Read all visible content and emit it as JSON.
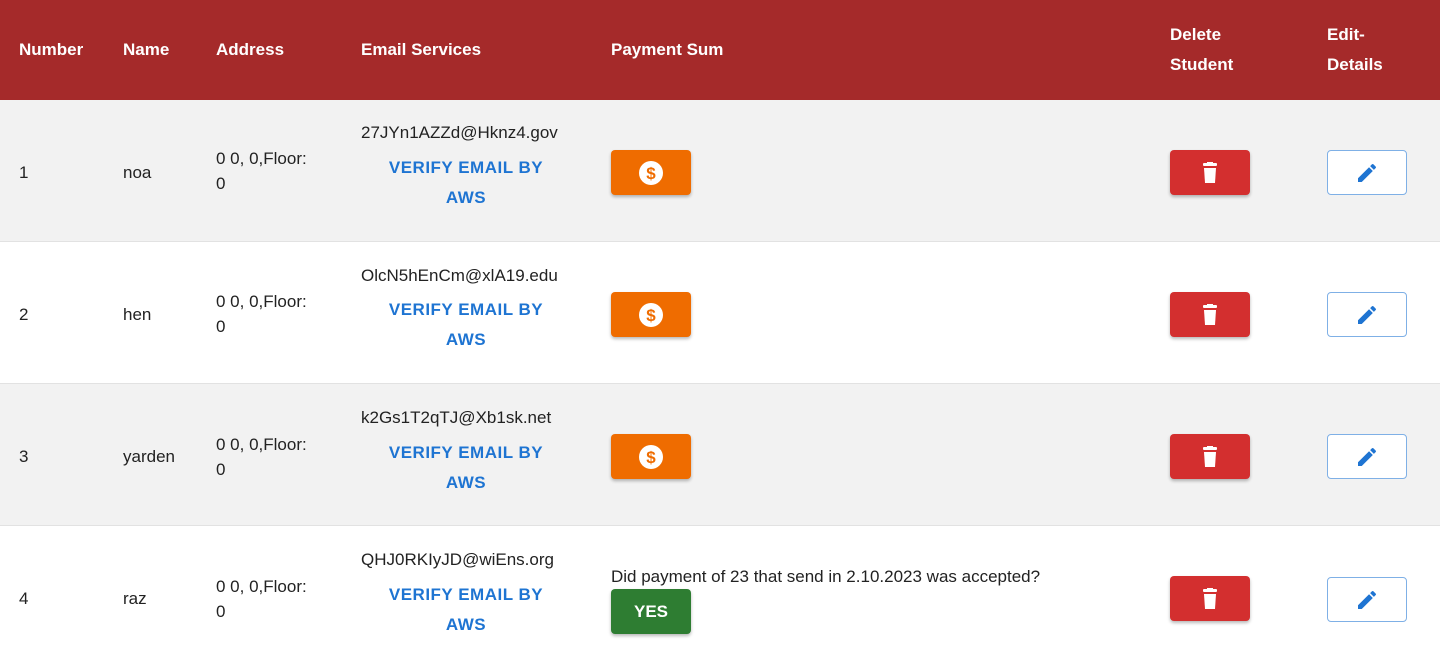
{
  "colors": {
    "header_bg": "#a52a2a",
    "payment_button": "#ef6c00",
    "delete_button": "#d32f2f",
    "edit_icon": "#1e74d2",
    "verify_link": "#1e74d2",
    "yes_button": "#2e7d32"
  },
  "header": {
    "number": "Number",
    "name": "Name",
    "address": "Address",
    "email_services": "Email Services",
    "payment_sum": "Payment Sum",
    "delete_student_line1": "Delete",
    "delete_student_line2": "Student",
    "edit_details_line1": "Edit-",
    "edit_details_line2": "Details"
  },
  "icons": {
    "payment": "dollar-circle-icon",
    "delete": "trash-icon",
    "edit": "pencil-icon"
  },
  "rows": [
    {
      "number": "1",
      "name": "noa",
      "address_line1": "0 0, 0,Floor:",
      "address_line2": "0",
      "email": "27JYn1AZZd@Hknz4.gov",
      "verify_line1": "VERIFY EMAIL BY",
      "verify_line2": "AWS"
    },
    {
      "number": "2",
      "name": "hen",
      "address_line1": "0 0, 0,Floor:",
      "address_line2": "0",
      "email": "OlcN5hEnCm@xlA19.edu",
      "verify_line1": "VERIFY EMAIL BY",
      "verify_line2": "AWS"
    },
    {
      "number": "3",
      "name": "yarden",
      "address_line1": "0 0, 0,Floor:",
      "address_line2": "0",
      "email": "k2Gs1T2qTJ@Xb1sk.net",
      "verify_line1": "VERIFY EMAIL BY",
      "verify_line2": "AWS"
    },
    {
      "number": "4",
      "name": "raz",
      "address_line1": "0 0, 0,Floor:",
      "address_line2": "0",
      "email": "QHJ0RKIyJD@wiEns.org",
      "verify_line1": "VERIFY EMAIL BY",
      "verify_line2": "AWS",
      "payment_question": "Did payment of 23 that send in 2.10.2023 was accepted?",
      "yes_label": "YES"
    }
  ]
}
